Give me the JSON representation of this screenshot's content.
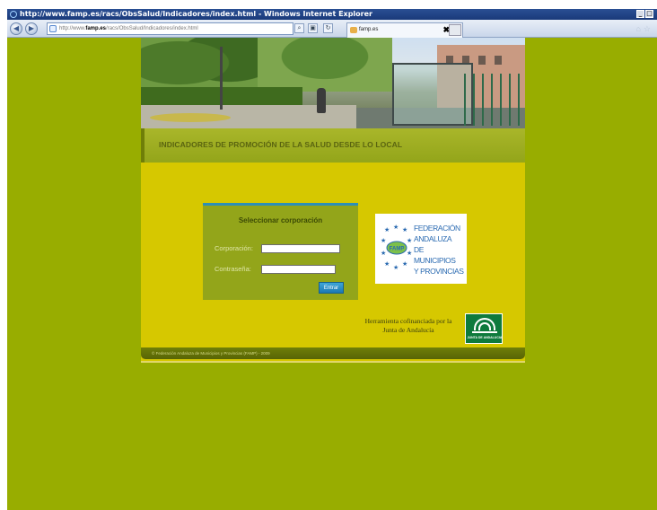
{
  "browser": {
    "window_title": "http://www.famp.es/racs/ObsSalud/Indicadores/index.html - Windows Internet Explorer",
    "address_prefix": "http://www.",
    "address_domain": "famp.es",
    "address_path": "/racs/ObsSalud/Indicadores/index.html",
    "tab_label": "famp.es",
    "tab_close": "✖"
  },
  "header": {
    "banner_title": "INDICADORES DE PROMOCIÓN DE LA SALUD DESDE LO LOCAL"
  },
  "login": {
    "title": "Seleccionar corporación",
    "corporacion_label": "Corporación:",
    "corporacion_value": "",
    "contrasena_label": "Contraseña:",
    "contrasena_value": "",
    "submit_label": "Entrar"
  },
  "famp_logo": {
    "lines": [
      "FEDERACIÓN",
      "ANDALUZA",
      "DE MUNICIPIOS",
      "Y PROVINCIAS"
    ],
    "emblem_text": "FAMP"
  },
  "cofinanciada": "Herramienta cofinanciada por la Junta de Andalucía",
  "junta_logo_text": "JUNTA DE ANDALUCIA",
  "footer": "© Federación Andaluza de Municipios y Provincias (FAMP) - 2009",
  "colors": {
    "page_bg": "#98ad00",
    "site_bg": "#d6c800",
    "accent_blue": "#2d8fb6"
  }
}
